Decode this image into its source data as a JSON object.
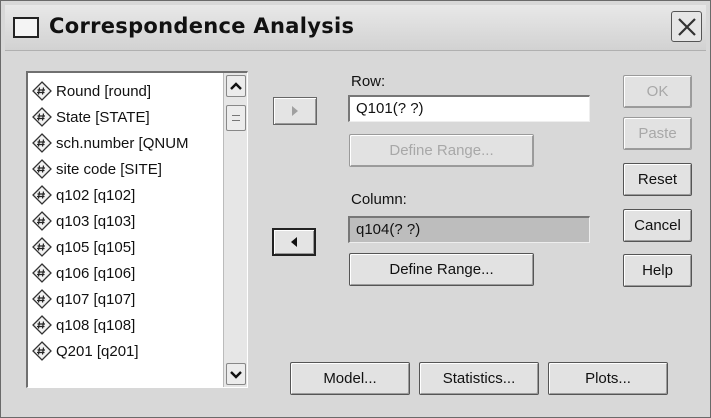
{
  "window": {
    "title": "Correspondence Analysis"
  },
  "variables": [
    "Round [round]",
    "State [STATE]",
    "sch.number [QNUM",
    "site code [SITE]",
    "q102 [q102]",
    "q103 [q103]",
    "q105 [q105]",
    "q106 [q106]",
    "q107 [q107]",
    "q108 [q108]",
    "Q201 [q201]"
  ],
  "row": {
    "label": "Row:",
    "value": "Q101(? ?)",
    "define_range": "Define Range..."
  },
  "column": {
    "label": "Column:",
    "value": "q104(? ?)",
    "define_range": "Define Range..."
  },
  "side_buttons": {
    "ok": "OK",
    "paste": "Paste",
    "reset": "Reset",
    "cancel": "Cancel",
    "help": "Help"
  },
  "bottom_buttons": {
    "model": "Model...",
    "statistics": "Statistics...",
    "plots": "Plots..."
  }
}
